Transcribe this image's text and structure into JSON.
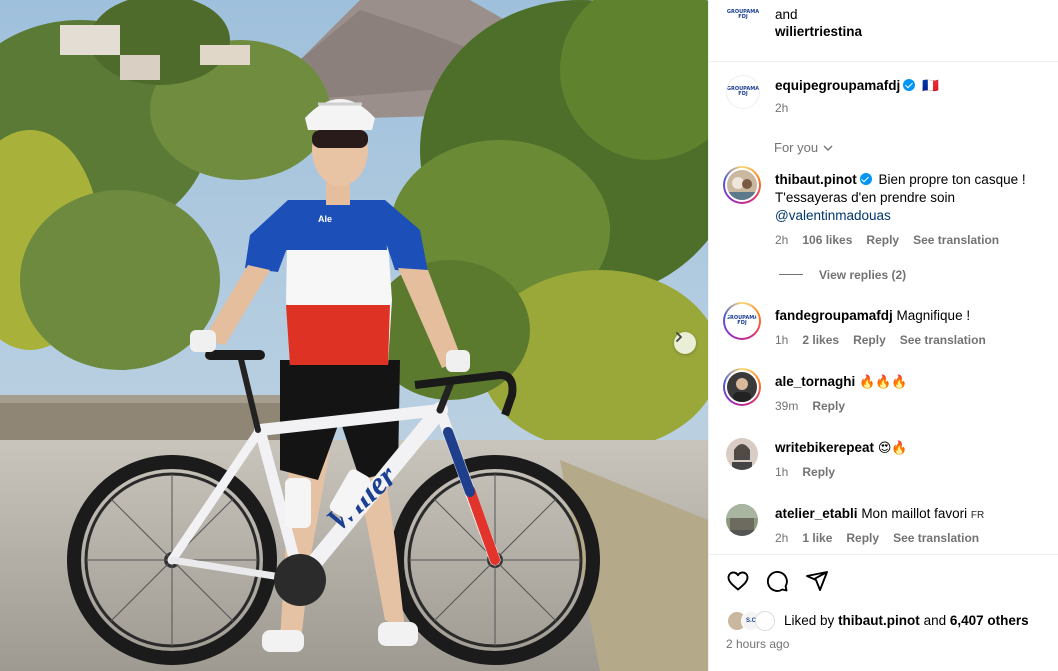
{
  "post": {
    "caption_tail": {
      "line1": "and",
      "line2": "wiliertriestina"
    },
    "author": {
      "username": "equipegroupamafdj",
      "flag": "🇫🇷",
      "time": "2h"
    },
    "sort_label": "For you",
    "comments": [
      {
        "username": "thibaut.pinot",
        "verified": true,
        "text": "Bien propre ton casque !",
        "text2": "T'essayeras d'en prendre soin",
        "mention": "@valentinmadouas",
        "time": "2h",
        "likes": "106 likes",
        "reply": "Reply",
        "translate": "See translation",
        "view_replies": "View replies (2)"
      },
      {
        "username": "fandegroupamafdj",
        "text": "Magnifique !",
        "time": "1h",
        "likes": "2 likes",
        "reply": "Reply",
        "translate": "See translation"
      },
      {
        "username": "ale_tornaghi",
        "text": "🔥🔥🔥",
        "time": "39m",
        "reply": "Reply"
      },
      {
        "username": "writebikerepeat",
        "text": "😍🔥",
        "time": "1h",
        "reply": "Reply"
      },
      {
        "username": "atelier_etabli",
        "text": "Mon maillot favori",
        "lang": "FR",
        "time": "2h",
        "likes": "1 like",
        "reply": "Reply",
        "translate": "See translation"
      }
    ],
    "likes_line": {
      "prefix": "Liked by",
      "user": "thibaut.pinot",
      "middle": "and",
      "others": "6,407 others"
    },
    "timestamp": "2 hours ago",
    "photo_text": {
      "brand": "Wilier",
      "helmet_brand": "Ale"
    },
    "colors": {
      "verified": "#0095f6",
      "link": "#00376b",
      "muted": "#737373"
    },
    "icons": [
      "heart-icon",
      "comment-icon",
      "share-icon",
      "chevron-right-icon",
      "chevron-down-icon",
      "verified-badge-icon"
    ]
  }
}
